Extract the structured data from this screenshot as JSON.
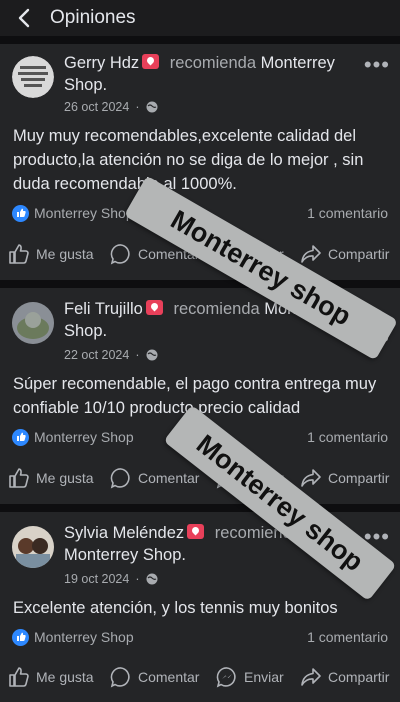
{
  "header": {
    "title": "Opiniones"
  },
  "posts": [
    {
      "author": "Gerry Hdz",
      "recommends": "recomienda",
      "page": "Monterrey Shop",
      "date": "26 oct 2024",
      "text": "Muy muy recomendables,excelente calidad del producto,la atención no se diga de lo mejor , sin duda recomendable al 1000%.",
      "reaction_name": "Monterrey Shop",
      "comments": "1 comentario"
    },
    {
      "author": "Feli Trujillo",
      "recommends": "recomienda",
      "page": "Monterrey Shop",
      "date": "22 oct 2024",
      "text": "Súper recomendable, el pago contra entrega muy confiable 10/10 producto precio calidad",
      "reaction_name": "Monterrey Shop",
      "comments": "1 comentario"
    },
    {
      "author": "Sylvia Meléndez",
      "recommends": "recomienda",
      "page": "Monterrey Shop",
      "date": "19 oct 2024",
      "text": "Excelente atención, y los tennis muy bonitos",
      "reaction_name": "Monterrey Shop",
      "comments": "1 comentario"
    }
  ],
  "actions": {
    "like": "Me gusta",
    "comment": "Comentar",
    "send": "Enviar",
    "share": "Compartir"
  },
  "watermark": "Monterrey shop",
  "colors": {
    "background": "#242527",
    "separator": "#0e0e10",
    "like_blue": "#2d88ff",
    "badge": "#e8405a",
    "stamp": "#b4b6b6"
  }
}
